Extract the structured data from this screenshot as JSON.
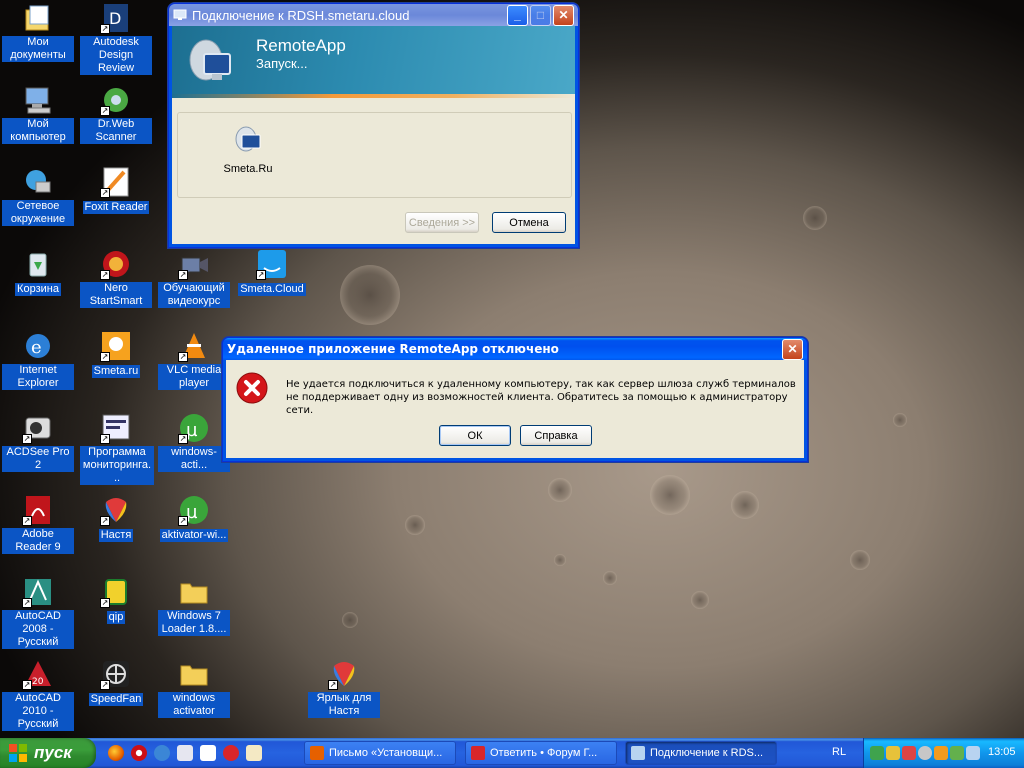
{
  "desktop_icons": [
    {
      "label": "Мои документы",
      "icon": "my-documents-icon"
    },
    {
      "label": "Autodesk Design Review",
      "icon": "autodesk-design-review-icon"
    },
    {
      "label": "Мой компьютер",
      "icon": "my-computer-icon"
    },
    {
      "label": "Dr.Web Scanner",
      "icon": "drweb-scanner-icon"
    },
    {
      "label": "Сетевое окружение",
      "icon": "network-places-icon"
    },
    {
      "label": "Foxit Reader",
      "icon": "foxit-reader-icon"
    },
    {
      "label": "Корзина",
      "icon": "recycle-bin-icon"
    },
    {
      "label": "Nero StartSmart",
      "icon": "nero-startsmart-icon"
    },
    {
      "label": "Обучающий видеокурс",
      "icon": "video-course-icon"
    },
    {
      "label": "Smeta.Cloud",
      "icon": "smeta-cloud-icon"
    },
    {
      "label": "Internet Explorer",
      "icon": "internet-explorer-icon"
    },
    {
      "label": "Smeta.ru",
      "icon": "smeta-ru-icon"
    },
    {
      "label": "VLC media player",
      "icon": "vlc-icon"
    },
    {
      "label": "ACDSee Pro 2",
      "icon": "acdsee-icon"
    },
    {
      "label": "Программа мониторинга...",
      "icon": "monitoring-program-icon"
    },
    {
      "label": "windows-acti...",
      "icon": "utorrent-icon"
    },
    {
      "label": "Adobe Reader 9",
      "icon": "adobe-reader-icon"
    },
    {
      "label": "Настя",
      "icon": "yandex-browser-icon"
    },
    {
      "label": "aktivator-wi...",
      "icon": "utorrent-icon"
    },
    {
      "label": "AutoCAD 2008 - Русский",
      "icon": "autocad-2008-icon"
    },
    {
      "label": "qip",
      "icon": "qip-icon"
    },
    {
      "label": "Windows 7 Loader 1.8....",
      "icon": "folder-icon"
    },
    {
      "label": "AutoCAD 2010 - Русский",
      "icon": "autocad-2010-icon"
    },
    {
      "label": "SpeedFan",
      "icon": "speedfan-icon"
    },
    {
      "label": "windows activator",
      "icon": "folder-icon"
    },
    {
      "label": "Ярлык для Настя",
      "icon": "yandex-browser-icon"
    }
  ],
  "remoteapp_window": {
    "title": "Подключение к RDSH.smetaru.cloud",
    "banner_title": "RemoteApp",
    "banner_status": "Запуск...",
    "program_label": "Smeta.Ru",
    "details_button": "Сведения >>",
    "cancel_button": "Отмена"
  },
  "error_dialog": {
    "title": "Удаленное приложение RemoteApp отключено",
    "message": "Не удается подключиться к удаленному компьютеру, так как сервер шлюза служб терминалов не поддерживает одну из возможностей клиента. Обратитесь за помощью к администратору сети.",
    "ok_button": "ОК",
    "help_button": "Справка"
  },
  "taskbar": {
    "start_label": "пуск",
    "buttons": [
      {
        "label": "Письмо «Установщи...",
        "icon": "firefox-icon"
      },
      {
        "label": "Ответить • Форум Г...",
        "icon": "yandex-browser-icon"
      },
      {
        "label": "Подключение к RDS...",
        "icon": "remote-desktop-icon",
        "active": true
      }
    ],
    "language": "RL",
    "clock": "13:05"
  },
  "colors": {
    "xp_blue": "#0054e3",
    "selection": "#0b55c5",
    "error_red": "#d4161a",
    "start_green": "#3a9d3a"
  }
}
